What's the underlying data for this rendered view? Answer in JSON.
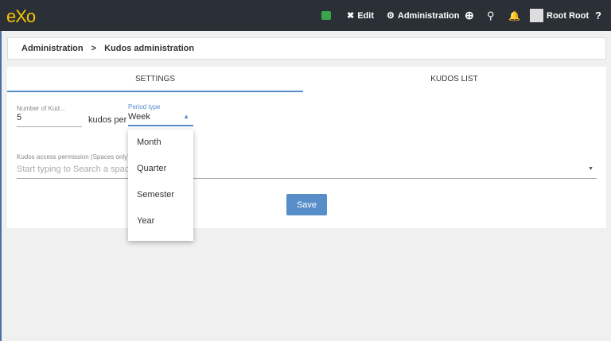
{
  "topbar": {
    "logo": "eXo",
    "edit": "Edit",
    "administration": "Administration",
    "user": "Root Root"
  },
  "breadcrumb": {
    "root": "Administration",
    "sep": ">",
    "current": "Kudos administration"
  },
  "tabs": [
    {
      "label": "Settings",
      "active": true
    },
    {
      "label": "Kudos list",
      "active": false
    }
  ],
  "form": {
    "number_label": "Number of Kud...",
    "number_value": "5",
    "kudos_per": "kudos per",
    "period_label": "Period type",
    "period_value": "Week",
    "permission_label": "Kudos access permission (Spaces only)",
    "permission_placeholder": "Start typing to Search a space",
    "save": "Save"
  },
  "period_options": [
    "Month",
    "Quarter",
    "Semester",
    "Year"
  ],
  "colors": {
    "accent": "#578dc9",
    "topbar": "#2b3036",
    "logo": "#f6c400"
  }
}
